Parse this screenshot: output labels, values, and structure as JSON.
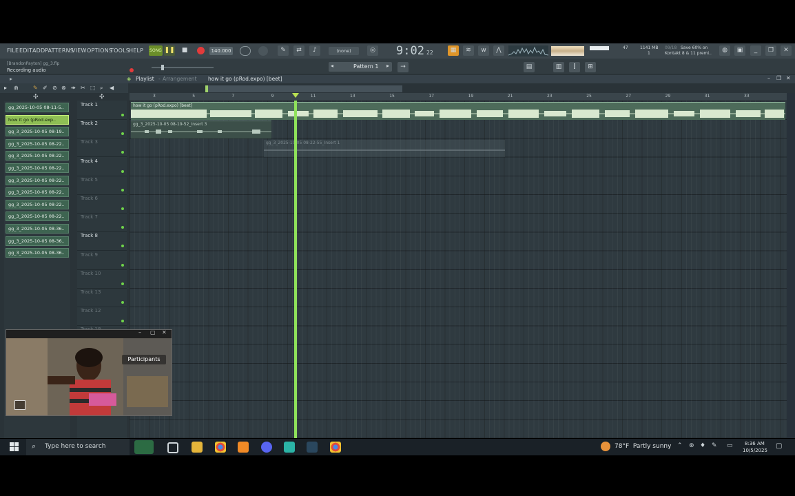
{
  "menu": [
    "FILE",
    "EDIT",
    "ADD",
    "PATTERNS",
    "VIEW",
    "OPTIONS",
    "TOOLS",
    "HELP"
  ],
  "transport": {
    "tempo": "140.000",
    "time": "9:02",
    "time_sub": "22",
    "pattern_select": "(none)",
    "pattern": "Pattern 1"
  },
  "status": {
    "memory": "1141 MB",
    "cpu_val": "47",
    "cpu_sub": "1",
    "news": "Save 60% on",
    "news2": "Kontakt 8 & 11 premi..",
    "news_id": "09/18"
  },
  "hint": {
    "title": "[BrandonPayton] gg_3.flp",
    "text": "Recording audio"
  },
  "playlist": {
    "label": "Playlist",
    "sep": "-",
    "view": "Arrangement",
    "song": "how it go (pRod.expo) [beet]"
  },
  "browser_clips": [
    {
      "label": "gg_2025-10-05 08-11-5..",
      "selected": false
    },
    {
      "label": "how it go (pRod.exp..",
      "selected": true
    },
    {
      "label": "gg_3_2025-10-05 08-19..",
      "selected": false
    },
    {
      "label": "gg_3_2025-10-05 08-22..",
      "selected": false
    },
    {
      "label": "gg_3_2025-10-05 08-22..",
      "selected": false
    },
    {
      "label": "gg_3_2025-10-05 08-22..",
      "selected": false
    },
    {
      "label": "gg_3_2025-10-05 08-22..",
      "selected": false
    },
    {
      "label": "gg_3_2025-10-05 08-22..",
      "selected": false
    },
    {
      "label": "gg_3_2025-10-05 08-22..",
      "selected": false
    },
    {
      "label": "gg_3_2025-10-05 08-22..",
      "selected": false
    },
    {
      "label": "gg_3_2025-10-05 08-36..",
      "selected": false
    },
    {
      "label": "gg_3_2025-10-05 08-36..",
      "selected": false
    },
    {
      "label": "gg_3_2025-10-05 08-36..",
      "selected": false
    }
  ],
  "tracks": [
    {
      "name": "Track 1",
      "dim": false
    },
    {
      "name": "Track 2",
      "dim": false
    },
    {
      "name": "Track 3",
      "dim": true
    },
    {
      "name": "Track 4",
      "dim": false
    },
    {
      "name": "Track 5",
      "dim": true
    },
    {
      "name": "Track 6",
      "dim": true
    },
    {
      "name": "Track 7",
      "dim": true
    },
    {
      "name": "Track 8",
      "dim": false
    },
    {
      "name": "Track 9",
      "dim": true
    },
    {
      "name": "Track 10",
      "dim": true
    },
    {
      "name": "Track 13",
      "dim": true
    },
    {
      "name": "Track 12",
      "dim": true
    },
    {
      "name": "Track 18",
      "dim": true
    }
  ],
  "ruler_ticks": [
    "3",
    "5",
    "7",
    "9",
    "11",
    "13",
    "15",
    "17",
    "19",
    "21",
    "23",
    "25",
    "27",
    "29",
    "31",
    "33"
  ],
  "clips": {
    "track1": "how it go (pRod.expo) [beet]",
    "track2": "gg_3_2025-10-05 08-19-52_Insert 3",
    "track3": "gg_3_2025-10-05 08-22-55_Insert 1"
  },
  "webcam": {
    "label": "Participants"
  },
  "taskbar": {
    "search": "Type here to search",
    "weather": "78°F  Partly sunny",
    "time": "8:36 AM",
    "date": "10/5/2025"
  }
}
